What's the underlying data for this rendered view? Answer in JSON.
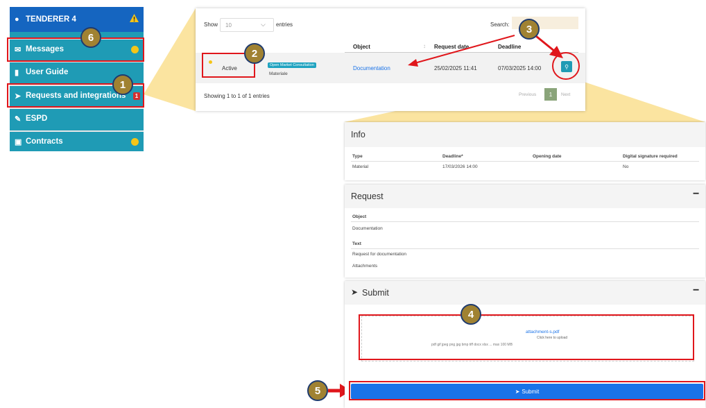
{
  "sidebar": {
    "header": "TENDERER 4",
    "items": [
      {
        "label": "Messages"
      },
      {
        "label": "User Guide"
      },
      {
        "label": "Requests and integrations",
        "badge": "1"
      },
      {
        "label": "ESPD"
      },
      {
        "label": "Contracts"
      }
    ]
  },
  "steps": [
    "1",
    "2",
    "3",
    "4",
    "5",
    "6"
  ],
  "table": {
    "show_label": "Show",
    "show_value": "10",
    "entries_label": "entries",
    "search_label": "Search:",
    "columns": [
      "Object",
      "Request date",
      "Deadline"
    ],
    "row": {
      "status": "Active",
      "tag": "Open Market Consultation",
      "subtype": "Materiale",
      "object": "Documentation",
      "request_date": "25/02/2025 11:41",
      "deadline": "07/03/2025 14:00"
    },
    "footer": "Showing 1 to 1 of 1 entries",
    "pager": {
      "previous": "Previous",
      "page": "1",
      "next": "Next"
    }
  },
  "info": {
    "title": "Info",
    "columns": [
      "Type",
      "Deadline*",
      "Opening date",
      "Digital signature required"
    ],
    "values": [
      "Material",
      "17/03/2026 14:00",
      "",
      "No"
    ]
  },
  "request": {
    "title": "Request",
    "minus": "−",
    "object_label": "Object",
    "object_value": "Documentation",
    "text_label": "Text",
    "text_value": "Request for documentation",
    "attachments_label": "Attachments"
  },
  "submit": {
    "title": "Submit",
    "minus": "−",
    "upload_link": "attachment-s.pdf",
    "upload_sub": "Click here to upload",
    "upload_hint": "pdf gif jpeg png jpg bmp tiff docx xlsx ... max 100 MB",
    "button_label": "Submit"
  },
  "colors": {
    "sidebar_bg": "#1f9bb5",
    "sidebar_header": "#1565c0",
    "highlight_red": "#e0161b",
    "step_badge": "#a08232",
    "callout_yellow": "#fbe4a0",
    "submit_blue": "#1a73e8"
  }
}
